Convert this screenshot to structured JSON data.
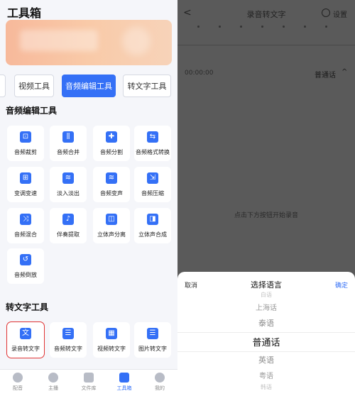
{
  "left": {
    "title": "工具箱",
    "tabs": [
      {
        "label": ""
      },
      {
        "label": "视频工具"
      },
      {
        "label": "音频编辑工具"
      },
      {
        "label": "转文字工具"
      }
    ],
    "audio_section_title": "音频编辑工具",
    "audio_tools": [
      {
        "label": "音频裁剪",
        "icon": "crop-icon",
        "glyph": "⊡"
      },
      {
        "label": "音频合并",
        "icon": "merge-icon",
        "glyph": "⫼"
      },
      {
        "label": "音频分割",
        "icon": "split-icon",
        "glyph": "✚"
      },
      {
        "label": "音频格式转换",
        "icon": "convert-icon",
        "glyph": "⇆"
      },
      {
        "label": "变调变速",
        "icon": "speed-icon",
        "glyph": "⊞"
      },
      {
        "label": "淡入淡出",
        "icon": "fade-icon",
        "glyph": "≋"
      },
      {
        "label": "音频变声",
        "icon": "voice-change-icon",
        "glyph": "≋"
      },
      {
        "label": "音频压缩",
        "icon": "compress-icon",
        "glyph": "⇲"
      },
      {
        "label": "音频混合",
        "icon": "mix-icon",
        "glyph": "⤨"
      },
      {
        "label": "伴奏提取",
        "icon": "extract-icon",
        "glyph": "♪"
      },
      {
        "label": "立体声分离",
        "icon": "stereo-split-icon",
        "glyph": "◫"
      },
      {
        "label": "立体声合成",
        "icon": "stereo-merge-icon",
        "glyph": "◨"
      },
      {
        "label": "音频倒放",
        "icon": "reverse-icon",
        "glyph": "↺"
      }
    ],
    "text_section_title": "转文字工具",
    "text_tools": [
      {
        "label": "录音转文字",
        "icon": "record-to-text-icon",
        "glyph": "文"
      },
      {
        "label": "音频转文字",
        "icon": "audio-to-text-icon",
        "glyph": "☰"
      },
      {
        "label": "视频转文字",
        "icon": "video-to-text-icon",
        "glyph": "▦"
      },
      {
        "label": "图片转文字",
        "icon": "image-to-text-icon",
        "glyph": "☰"
      }
    ],
    "nav": [
      {
        "label": "配音",
        "icon": "dubbing-icon"
      },
      {
        "label": "主播",
        "icon": "anchor-icon"
      },
      {
        "label": "文件库",
        "icon": "folder-icon"
      },
      {
        "label": "工具箱",
        "icon": "toolbox-icon"
      },
      {
        "label": "我的",
        "icon": "profile-icon"
      }
    ]
  },
  "right": {
    "back_glyph": "<",
    "title": "录音转文字",
    "settings_label": "设置",
    "time": "00:00:00",
    "language": "普通话",
    "chevron": "^",
    "hint": "点击下方按钮开始录音",
    "sheet": {
      "cancel": "取消",
      "title": "选择语言",
      "confirm": "确定",
      "options": [
        "白语",
        "上海话",
        "泰语",
        "普通话",
        "英语",
        "粤语",
        "韩语"
      ],
      "selected_index": 3
    }
  },
  "colors": {
    "accent": "#3470f6",
    "selection_outline": "#e03333",
    "overlay": "#5a5a5a"
  }
}
